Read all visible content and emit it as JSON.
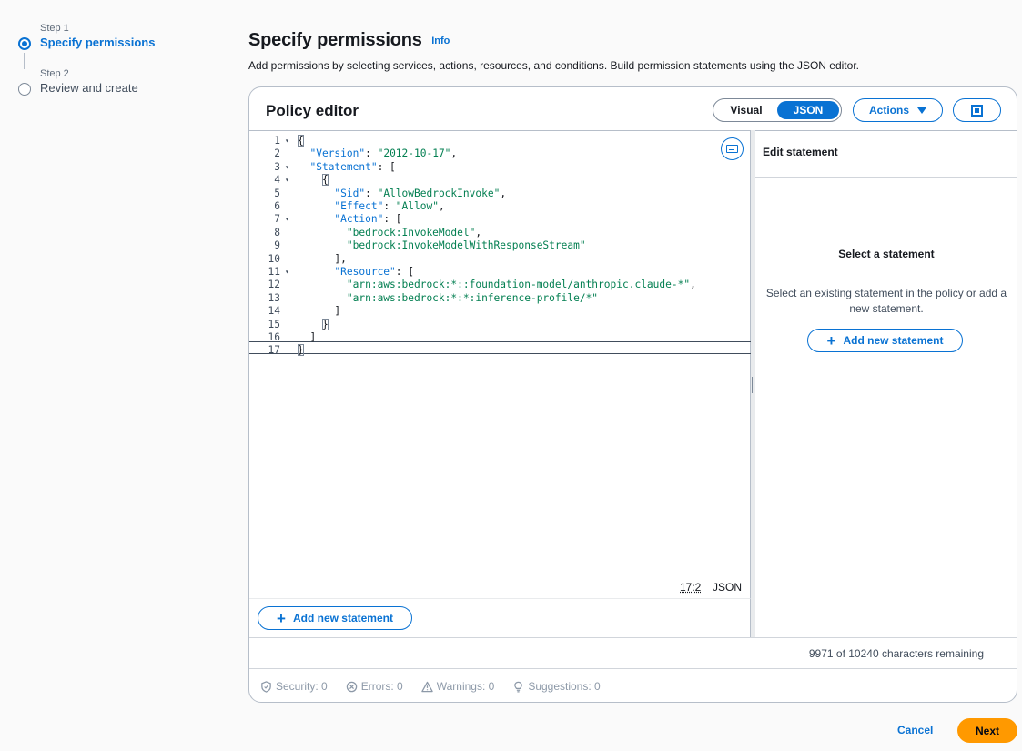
{
  "steps": [
    {
      "num": "Step 1",
      "title": "Specify permissions"
    },
    {
      "num": "Step 2",
      "title": "Review and create"
    }
  ],
  "header": {
    "title": "Specify permissions",
    "info": "Info",
    "description": "Add permissions by selecting services, actions, resources, and conditions. Build permission statements using the JSON editor."
  },
  "editor": {
    "title": "Policy editor",
    "mode_visual": "Visual",
    "mode_json": "JSON",
    "actions_label": "Actions",
    "cursor_position": "17:2",
    "language": "JSON",
    "add_statement_label": "Add new statement",
    "lines": [
      {
        "n": "1",
        "fold": true,
        "code": "{"
      },
      {
        "n": "2",
        "fold": false,
        "code": "  \"Version\": \"2012-10-17\","
      },
      {
        "n": "3",
        "fold": true,
        "code": "  \"Statement\": ["
      },
      {
        "n": "4",
        "fold": true,
        "code": "    {"
      },
      {
        "n": "5",
        "fold": false,
        "code": "      \"Sid\": \"AllowBedrockInvoke\","
      },
      {
        "n": "6",
        "fold": false,
        "code": "      \"Effect\": \"Allow\","
      },
      {
        "n": "7",
        "fold": true,
        "code": "      \"Action\": ["
      },
      {
        "n": "8",
        "fold": false,
        "code": "        \"bedrock:InvokeModel\","
      },
      {
        "n": "9",
        "fold": false,
        "code": "        \"bedrock:InvokeModelWithResponseStream\""
      },
      {
        "n": "10",
        "fold": false,
        "code": "      ],"
      },
      {
        "n": "11",
        "fold": true,
        "code": "      \"Resource\": ["
      },
      {
        "n": "12",
        "fold": false,
        "code": "        \"arn:aws:bedrock:*::foundation-model/anthropic.claude-*\","
      },
      {
        "n": "13",
        "fold": false,
        "code": "        \"arn:aws:bedrock:*:*:inference-profile/*\""
      },
      {
        "n": "14",
        "fold": false,
        "code": "      ]"
      },
      {
        "n": "15",
        "fold": false,
        "code": "    }"
      },
      {
        "n": "16",
        "fold": false,
        "code": "  ]"
      },
      {
        "n": "17",
        "fold": false,
        "code": "}"
      }
    ]
  },
  "statement_panel": {
    "title": "Edit statement",
    "empty_title": "Select a statement",
    "empty_desc": "Select an existing statement in the policy or add a new statement.",
    "add_label": "Add new statement"
  },
  "footer": {
    "chars_remaining": "9971 of 10240 characters remaining",
    "checks": {
      "security": "Security: 0",
      "errors": "Errors: 0",
      "warnings": "Warnings: 0",
      "suggestions": "Suggestions: 0"
    }
  },
  "page_buttons": {
    "cancel": "Cancel",
    "next": "Next"
  },
  "colors": {
    "accent": "#0972d3",
    "primary_button": "#ff9900",
    "string": "#037f51"
  },
  "icons": [
    "keyboard-icon",
    "fullscreen-icon",
    "caret-down-icon",
    "plus-icon",
    "shield-icon",
    "error-icon",
    "warning-icon",
    "lightbulb-icon"
  ]
}
